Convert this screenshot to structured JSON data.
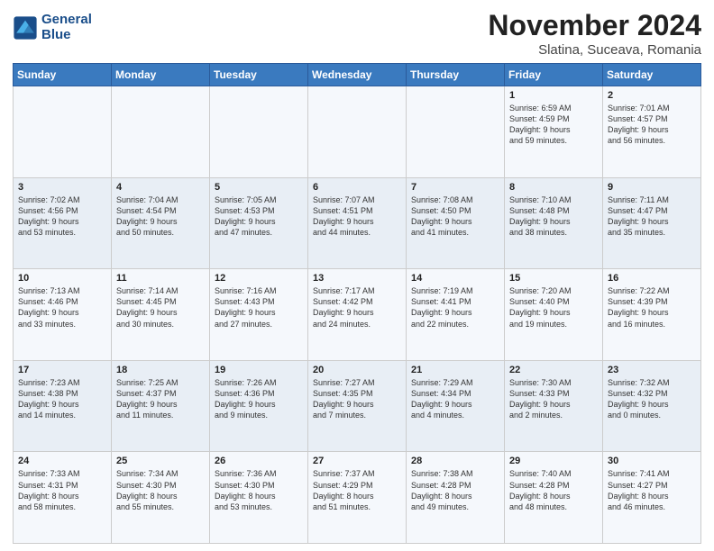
{
  "logo": {
    "line1": "General",
    "line2": "Blue"
  },
  "title": "November 2024",
  "subtitle": "Slatina, Suceava, Romania",
  "weekdays": [
    "Sunday",
    "Monday",
    "Tuesday",
    "Wednesday",
    "Thursday",
    "Friday",
    "Saturday"
  ],
  "weeks": [
    [
      {
        "day": "",
        "info": ""
      },
      {
        "day": "",
        "info": ""
      },
      {
        "day": "",
        "info": ""
      },
      {
        "day": "",
        "info": ""
      },
      {
        "day": "",
        "info": ""
      },
      {
        "day": "1",
        "info": "Sunrise: 6:59 AM\nSunset: 4:59 PM\nDaylight: 9 hours\nand 59 minutes."
      },
      {
        "day": "2",
        "info": "Sunrise: 7:01 AM\nSunset: 4:57 PM\nDaylight: 9 hours\nand 56 minutes."
      }
    ],
    [
      {
        "day": "3",
        "info": "Sunrise: 7:02 AM\nSunset: 4:56 PM\nDaylight: 9 hours\nand 53 minutes."
      },
      {
        "day": "4",
        "info": "Sunrise: 7:04 AM\nSunset: 4:54 PM\nDaylight: 9 hours\nand 50 minutes."
      },
      {
        "day": "5",
        "info": "Sunrise: 7:05 AM\nSunset: 4:53 PM\nDaylight: 9 hours\nand 47 minutes."
      },
      {
        "day": "6",
        "info": "Sunrise: 7:07 AM\nSunset: 4:51 PM\nDaylight: 9 hours\nand 44 minutes."
      },
      {
        "day": "7",
        "info": "Sunrise: 7:08 AM\nSunset: 4:50 PM\nDaylight: 9 hours\nand 41 minutes."
      },
      {
        "day": "8",
        "info": "Sunrise: 7:10 AM\nSunset: 4:48 PM\nDaylight: 9 hours\nand 38 minutes."
      },
      {
        "day": "9",
        "info": "Sunrise: 7:11 AM\nSunset: 4:47 PM\nDaylight: 9 hours\nand 35 minutes."
      }
    ],
    [
      {
        "day": "10",
        "info": "Sunrise: 7:13 AM\nSunset: 4:46 PM\nDaylight: 9 hours\nand 33 minutes."
      },
      {
        "day": "11",
        "info": "Sunrise: 7:14 AM\nSunset: 4:45 PM\nDaylight: 9 hours\nand 30 minutes."
      },
      {
        "day": "12",
        "info": "Sunrise: 7:16 AM\nSunset: 4:43 PM\nDaylight: 9 hours\nand 27 minutes."
      },
      {
        "day": "13",
        "info": "Sunrise: 7:17 AM\nSunset: 4:42 PM\nDaylight: 9 hours\nand 24 minutes."
      },
      {
        "day": "14",
        "info": "Sunrise: 7:19 AM\nSunset: 4:41 PM\nDaylight: 9 hours\nand 22 minutes."
      },
      {
        "day": "15",
        "info": "Sunrise: 7:20 AM\nSunset: 4:40 PM\nDaylight: 9 hours\nand 19 minutes."
      },
      {
        "day": "16",
        "info": "Sunrise: 7:22 AM\nSunset: 4:39 PM\nDaylight: 9 hours\nand 16 minutes."
      }
    ],
    [
      {
        "day": "17",
        "info": "Sunrise: 7:23 AM\nSunset: 4:38 PM\nDaylight: 9 hours\nand 14 minutes."
      },
      {
        "day": "18",
        "info": "Sunrise: 7:25 AM\nSunset: 4:37 PM\nDaylight: 9 hours\nand 11 minutes."
      },
      {
        "day": "19",
        "info": "Sunrise: 7:26 AM\nSunset: 4:36 PM\nDaylight: 9 hours\nand 9 minutes."
      },
      {
        "day": "20",
        "info": "Sunrise: 7:27 AM\nSunset: 4:35 PM\nDaylight: 9 hours\nand 7 minutes."
      },
      {
        "day": "21",
        "info": "Sunrise: 7:29 AM\nSunset: 4:34 PM\nDaylight: 9 hours\nand 4 minutes."
      },
      {
        "day": "22",
        "info": "Sunrise: 7:30 AM\nSunset: 4:33 PM\nDaylight: 9 hours\nand 2 minutes."
      },
      {
        "day": "23",
        "info": "Sunrise: 7:32 AM\nSunset: 4:32 PM\nDaylight: 9 hours\nand 0 minutes."
      }
    ],
    [
      {
        "day": "24",
        "info": "Sunrise: 7:33 AM\nSunset: 4:31 PM\nDaylight: 8 hours\nand 58 minutes."
      },
      {
        "day": "25",
        "info": "Sunrise: 7:34 AM\nSunset: 4:30 PM\nDaylight: 8 hours\nand 55 minutes."
      },
      {
        "day": "26",
        "info": "Sunrise: 7:36 AM\nSunset: 4:30 PM\nDaylight: 8 hours\nand 53 minutes."
      },
      {
        "day": "27",
        "info": "Sunrise: 7:37 AM\nSunset: 4:29 PM\nDaylight: 8 hours\nand 51 minutes."
      },
      {
        "day": "28",
        "info": "Sunrise: 7:38 AM\nSunset: 4:28 PM\nDaylight: 8 hours\nand 49 minutes."
      },
      {
        "day": "29",
        "info": "Sunrise: 7:40 AM\nSunset: 4:28 PM\nDaylight: 8 hours\nand 48 minutes."
      },
      {
        "day": "30",
        "info": "Sunrise: 7:41 AM\nSunset: 4:27 PM\nDaylight: 8 hours\nand 46 minutes."
      }
    ]
  ]
}
